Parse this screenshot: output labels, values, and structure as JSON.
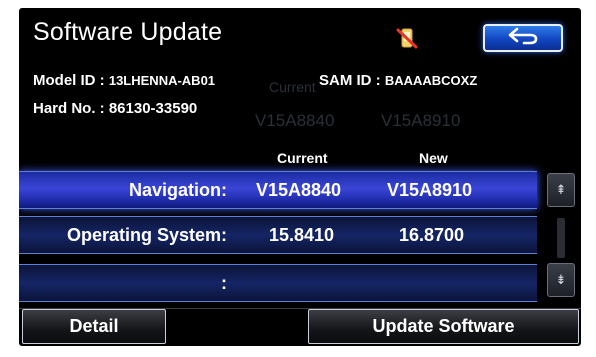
{
  "header": {
    "title": "Software Update",
    "status_icon": "no-phone-icon",
    "back_icon": "return-arrow-icon"
  },
  "info": {
    "model_id_label": "Model ID :",
    "model_id_value": "13LHENNA-AB01",
    "sam_id_label": "SAM ID :",
    "sam_id_value": "BAAAABCOXZ",
    "hard_no_label": "Hard No. :",
    "hard_no_value": "86130-33590"
  },
  "ghost_text": {
    "current_ghost": "Current",
    "current_value_ghost": "V15A8840",
    "new_value_ghost": "V15A8910"
  },
  "columns": {
    "current": "Current",
    "new": "New"
  },
  "rows": [
    {
      "name": "Navigation:",
      "current": "V15A8840",
      "new": "V15A8910",
      "selected": true
    },
    {
      "name": "Operating System:",
      "current": "15.8410",
      "new": "16.8700",
      "selected": false
    },
    {
      "name": ":",
      "current": "",
      "new": "",
      "selected": false
    }
  ],
  "scroll": {
    "up_icon": "scroll-up-double-chevron-icon",
    "down_icon": "scroll-down-double-chevron-icon",
    "up_glyph": "⇞",
    "down_glyph": "⇟"
  },
  "footer": {
    "detail_label": "Detail",
    "update_label": "Update Software"
  },
  "colors": {
    "accent_blue": "#2f7de8",
    "row_selected": "#3a45d6",
    "row_normal": "#152566",
    "background": "#000000"
  }
}
